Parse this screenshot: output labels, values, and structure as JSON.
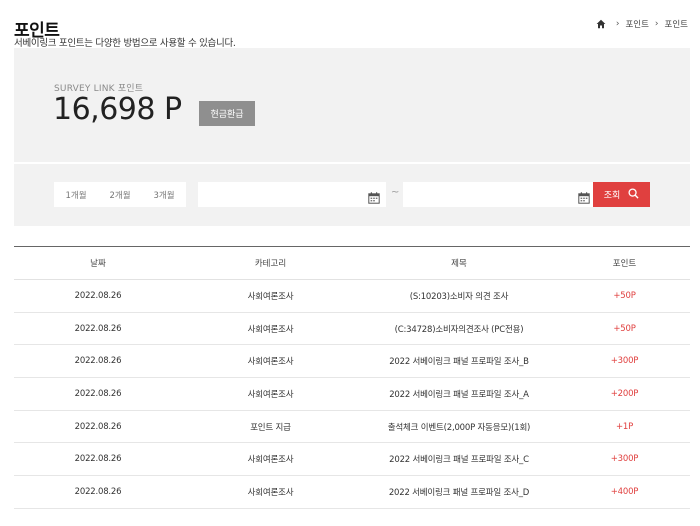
{
  "header": {
    "title": "포인트",
    "subtitle": "서베이링크 포인트는 다양한 방법으로 사용할 수 있습니다."
  },
  "breadcrumb": {
    "icon": "home-icon",
    "items": [
      "포인트",
      "포인트"
    ]
  },
  "points": {
    "label": "SURVEY LINK 포인트",
    "value": "16,698 P",
    "refund_label": "현금환급"
  },
  "filter": {
    "periods": [
      "1개월",
      "2개월",
      "3개월"
    ],
    "start_date": "",
    "end_date": "",
    "separator": "~",
    "search_label": "조회",
    "icons": {
      "calendar": "calendar-icon",
      "search": "search-icon"
    }
  },
  "table": {
    "headers": [
      "날짜",
      "카테고리",
      "제목",
      "포인트"
    ],
    "rows": [
      {
        "date": "2022.08.26",
        "category": "사회여론조사",
        "title": "(S:10203)소비자 의견 조사",
        "points": "+50P"
      },
      {
        "date": "2022.08.26",
        "category": "사회여론조사",
        "title": "(C:34728)소비자의견조사 (PC전용)",
        "points": "+50P"
      },
      {
        "date": "2022.08.26",
        "category": "사회여론조사",
        "title": "2022 서베이링크 패널 프로파일 조사_B",
        "points": "+300P"
      },
      {
        "date": "2022.08.26",
        "category": "사회여론조사",
        "title": "2022 서베이링크 패널 프로파일 조사_A",
        "points": "+200P"
      },
      {
        "date": "2022.08.26",
        "category": "포인트 지급",
        "title": "출석체크 이벤트(2,000P 자동응모)(1회)",
        "points": "+1P"
      },
      {
        "date": "2022.08.26",
        "category": "사회여론조사",
        "title": "2022 서베이링크 패널 프로파일 조사_C",
        "points": "+300P"
      },
      {
        "date": "2022.08.26",
        "category": "사회여론조사",
        "title": "2022 서베이링크 패널 프로파일 조사_D",
        "points": "+400P"
      }
    ]
  },
  "colors": {
    "accent": "#e0403f",
    "panel_bg": "#f2f2f2",
    "refund_button": "#8f8f8f"
  }
}
